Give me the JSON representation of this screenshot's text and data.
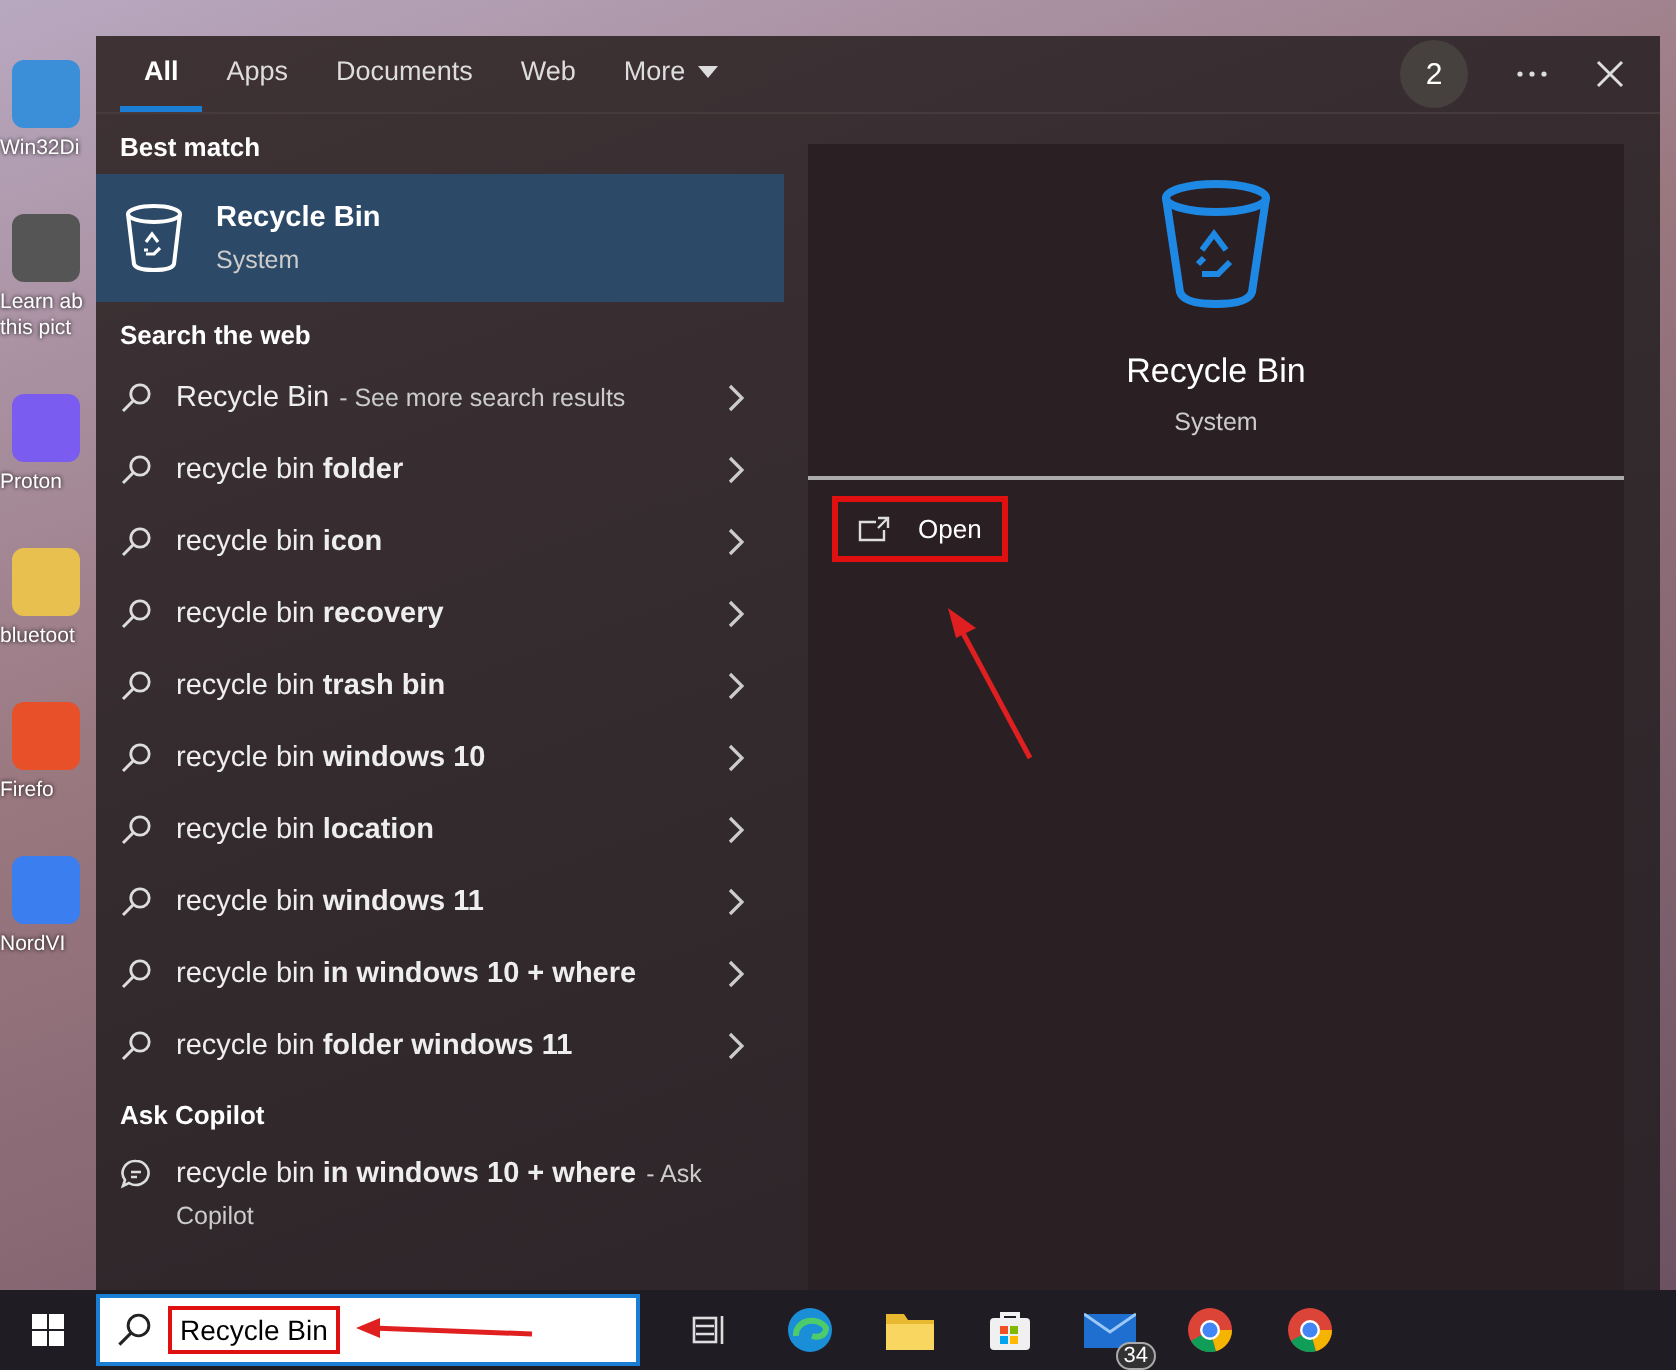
{
  "desktop_icons": [
    {
      "kind": "tool",
      "label": "Win32Di"
    },
    {
      "kind": "photo",
      "label": "Learn ab",
      "label_2": "this pict"
    },
    {
      "kind": "vpn",
      "label": "Proton"
    },
    {
      "kind": "folder",
      "label": "bluetoot"
    },
    {
      "kind": "browser",
      "label": "Firefo"
    },
    {
      "kind": "shield",
      "label": "NordVI"
    }
  ],
  "tabs": [
    {
      "label": "All",
      "selected": true
    },
    {
      "label": "Apps",
      "selected": false
    },
    {
      "label": "Documents",
      "selected": false
    },
    {
      "label": "Web",
      "selected": false
    },
    {
      "label": "More",
      "selected": false,
      "dropdown": true
    }
  ],
  "header_badge": "2",
  "best_match": {
    "heading": "Best match",
    "title": "Recycle Bin",
    "subtitle": "System",
    "selected": true
  },
  "web": {
    "heading": "Search the web",
    "items": [
      {
        "text": "Recycle Bin",
        "note": "- See more search results"
      },
      {
        "text": "recycle bin **folder**"
      },
      {
        "text": "recycle bin **icon**"
      },
      {
        "text": "recycle bin **recovery**"
      },
      {
        "text": "recycle bin **trash bin**"
      },
      {
        "text": "recycle bin **windows 10**"
      },
      {
        "text": "recycle bin **location**"
      },
      {
        "text": "recycle bin **windows 11**"
      },
      {
        "text": "recycle bin **in windows 10 + where**"
      },
      {
        "text": "recycle bin **folder windows 11**"
      }
    ]
  },
  "copilot": {
    "heading": "Ask Copilot",
    "text": "recycle bin **in windows 10 + where**",
    "note": "- Ask Copilot"
  },
  "preview": {
    "title": "Recycle Bin",
    "subtitle": "System",
    "actions": [
      {
        "label": "Open",
        "highlighted": true
      }
    ]
  },
  "taskbar": {
    "search": {
      "value": "Recycle Bin",
      "highlighted": true
    },
    "apps": [
      {
        "kind": "taskview"
      },
      {
        "kind": "edge"
      },
      {
        "kind": "folder"
      },
      {
        "kind": "store"
      },
      {
        "kind": "mail",
        "badge": "34"
      },
      {
        "kind": "chrome"
      },
      {
        "kind": "chrome"
      }
    ]
  }
}
